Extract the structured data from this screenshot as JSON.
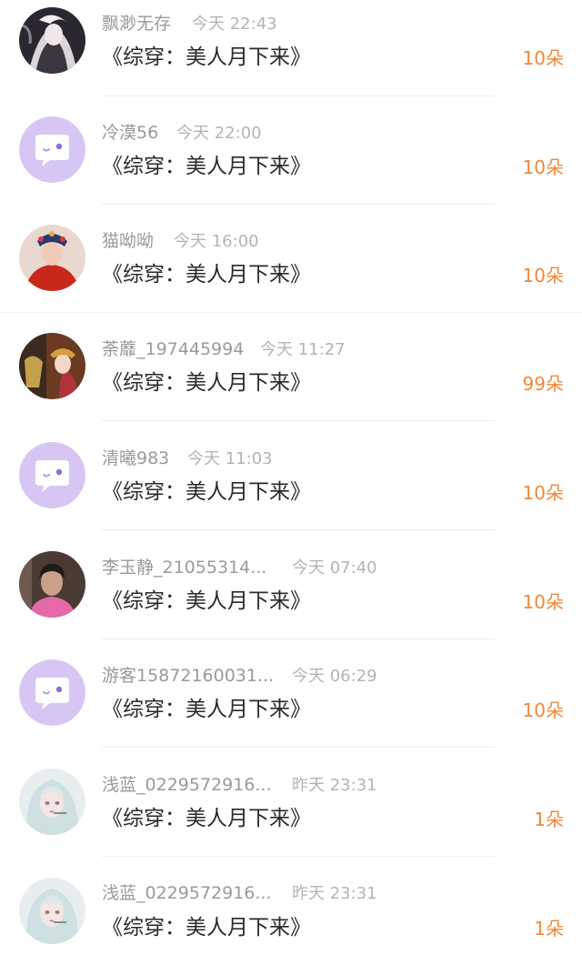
{
  "items": [
    {
      "user": "飘渺无存",
      "time": "今天 22:43",
      "book": "《综穿：美人月下来》",
      "gift": "10朵",
      "avatar": "dark-anime-avatar"
    },
    {
      "user": "冷漠56",
      "time": "今天 22:00",
      "book": "《综穿：美人月下来》",
      "gift": "10朵",
      "avatar": "default-chat-avatar"
    },
    {
      "user": "猫呦呦",
      "time": "今天 16:00",
      "book": "《综穿：美人月下来》",
      "gift": "10朵",
      "avatar": "red-costume-avatar"
    },
    {
      "user": "荼蘼_197445994",
      "time": "今天 11:27",
      "book": "《综穿：美人月下来》",
      "gift": "99朵",
      "avatar": "opera-avatar"
    },
    {
      "user": "清曦983",
      "time": "今天 11:03",
      "book": "《综穿：美人月下来》",
      "gift": "10朵",
      "avatar": "default-chat-avatar"
    },
    {
      "user": "李玉静_21055314...",
      "time": "今天 07:40",
      "book": "《综穿：美人月下来》",
      "gift": "10朵",
      "avatar": "photo-avatar"
    },
    {
      "user": "游客15872160031...",
      "time": "今天 06:29",
      "book": "《综穿：美人月下来》",
      "gift": "10朵",
      "avatar": "default-chat-avatar"
    },
    {
      "user": "浅蓝_0229572916...",
      "time": "昨天 23:31",
      "book": "《综穿：美人月下来》",
      "gift": "1朵",
      "avatar": "silver-hair-avatar"
    },
    {
      "user": "浅蓝_0229572916...",
      "time": "昨天 23:31",
      "book": "《综穿：美人月下来》",
      "gift": "1朵",
      "avatar": "silver-hair-avatar"
    }
  ],
  "colors": {
    "accent": "#f0883a",
    "default_avatar": "#d7c6f4"
  }
}
